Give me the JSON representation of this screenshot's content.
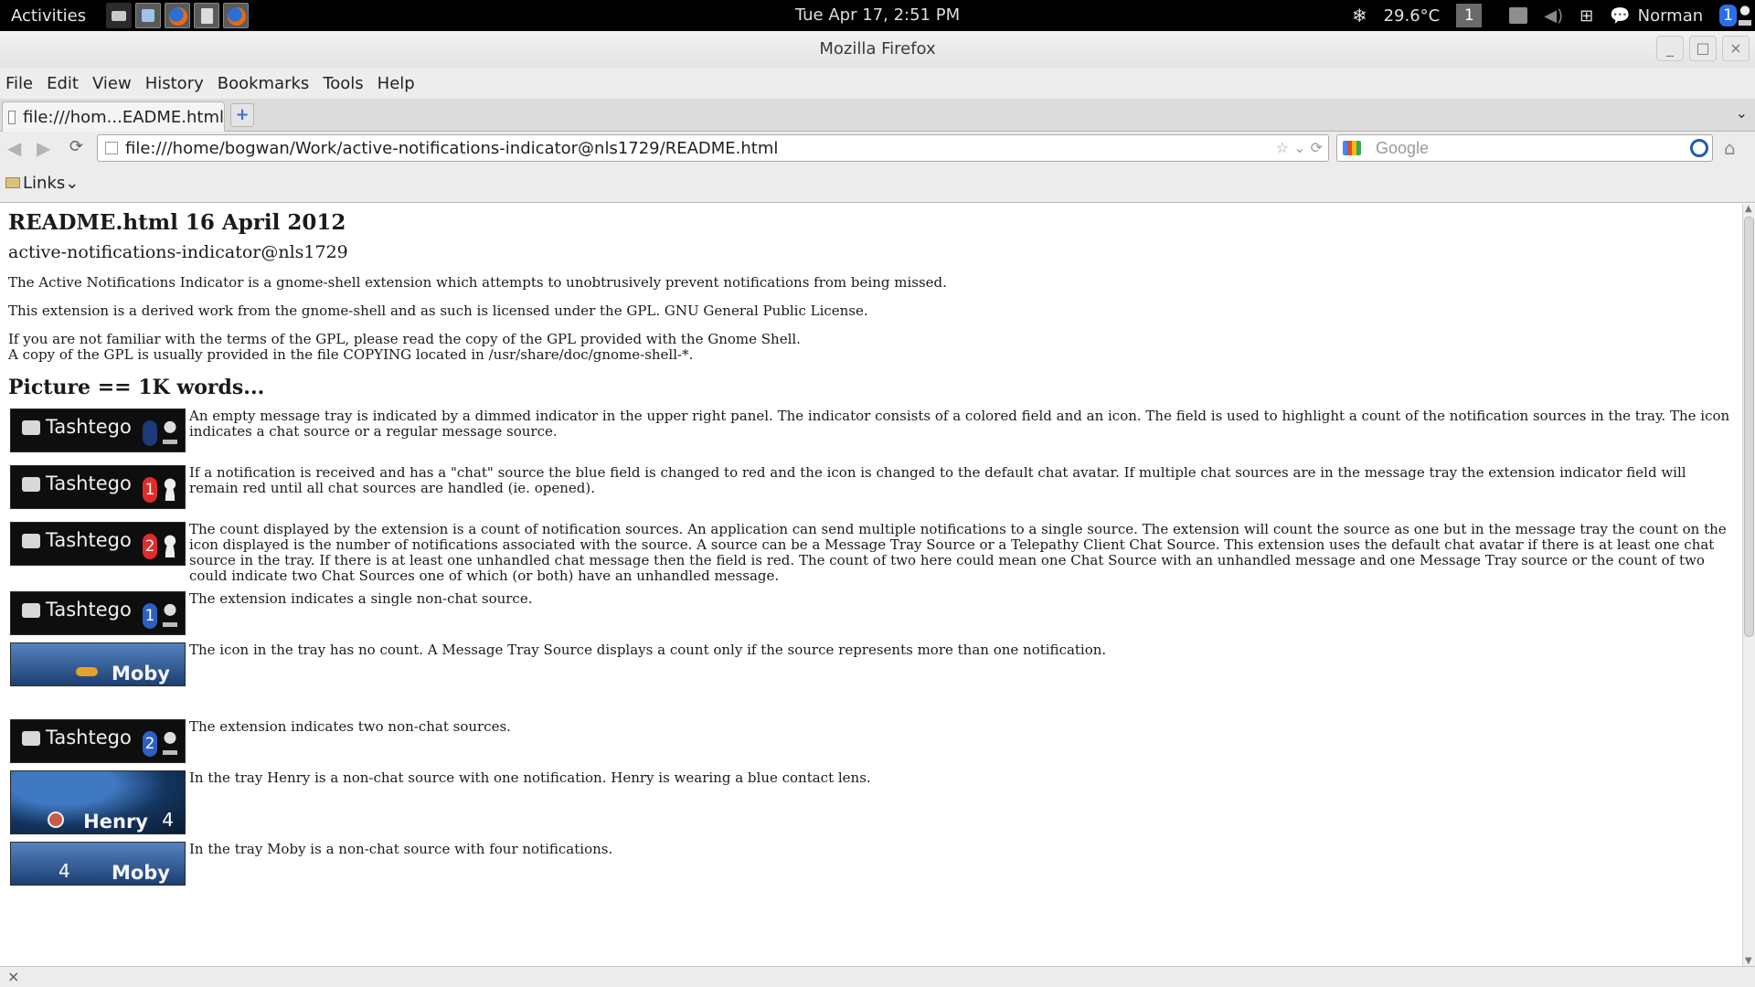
{
  "panel": {
    "activities": "Activities",
    "clock": "Tue Apr 17,  2:51 PM",
    "temperature": "29.6°C",
    "workspace": "1",
    "user": "Norman",
    "notification_count": "1"
  },
  "window": {
    "title": "Mozilla Firefox",
    "minimize": "_",
    "maximize": "□",
    "close": "×"
  },
  "menu": [
    "File",
    "Edit",
    "View",
    "History",
    "Bookmarks",
    "Tools",
    "Help"
  ],
  "tab": {
    "title": "file:///hom...EADME.html",
    "new_tab": "+",
    "list": "⌄"
  },
  "nav": {
    "url": "file:///home/bogwan/Work/active-notifications-indicator@nls1729/README.html",
    "search_placeholder": "Google"
  },
  "bookmarks": {
    "folder": "Links"
  },
  "page": {
    "h1": "README.html 16 April 2012",
    "h2": "active-notifications-indicator@nls1729",
    "p1": "The Active Notifications Indicator is a gnome-shell extension which attempts to unobtrusively prevent notifications from being missed.",
    "p2": "This extension is a derived work from the gnome-shell and as such is licensed under the GPL. GNU General Public License.",
    "p3a": "If you are not familiar with the terms of the GPL, please read the copy of the GPL provided with the Gnome Shell.",
    "p3b": "A copy of the GPL is usually provided in the file COPYING located in /usr/share/doc/gnome-shell-*.",
    "h3": "Picture == 1K words...",
    "rows": [
      {
        "img": "Tashtego",
        "count": "",
        "text": "An empty message tray is indicated by a dimmed indicator in the upper right panel. The indicator consists of a colored field and an icon. The field is used to highlight a count of the notification sources in the tray. The icon indicates a chat source or a regular message source."
      },
      {
        "img": "Tashtego",
        "count": "1",
        "text": "If a notification is received and has a \"chat\" source the blue field is changed to red and the icon is changed to the default chat avatar. If multiple chat sources are in the message tray the extension indicator field will remain red until all chat sources are handled (ie. opened)."
      },
      {
        "img": "Tashtego",
        "count": "2",
        "text": "The count displayed by the extension is a count of notification sources. An application can send multiple notifications to a single source. The extension will count the source as one but in the message tray the count on the icon displayed is the number of notifications associated with the source. A source can be a Message Tray Source or a Telepathy Client Chat Source. This extension uses the default chat avatar if there is at least one chat source in the tray. If there is at least one unhandled chat message then the field is red. The count of two here could mean one Chat Source with an unhandled message and one Message Tray source or the count of two could indicate two Chat Sources one of which (or both) have an unhandled message."
      },
      {
        "img": "Tashtego",
        "count": "1",
        "text": "The extension indicates a single non-chat source."
      },
      {
        "img": "Moby",
        "count": "",
        "text": "The icon in the tray has no count. A Message Tray Source displays a count only if the source represents more than one notification."
      },
      {
        "img": "Tashtego",
        "count": "2",
        "text": "The extension indicates two non-chat sources."
      },
      {
        "img": "Henry",
        "count": "4",
        "text": "In the tray Henry is a non-chat source with one notification. Henry is wearing a blue contact lens."
      },
      {
        "img": "Moby",
        "count": "4",
        "text": "In the tray Moby is a non-chat source with four notifications."
      }
    ]
  },
  "status": {
    "close": "×"
  }
}
